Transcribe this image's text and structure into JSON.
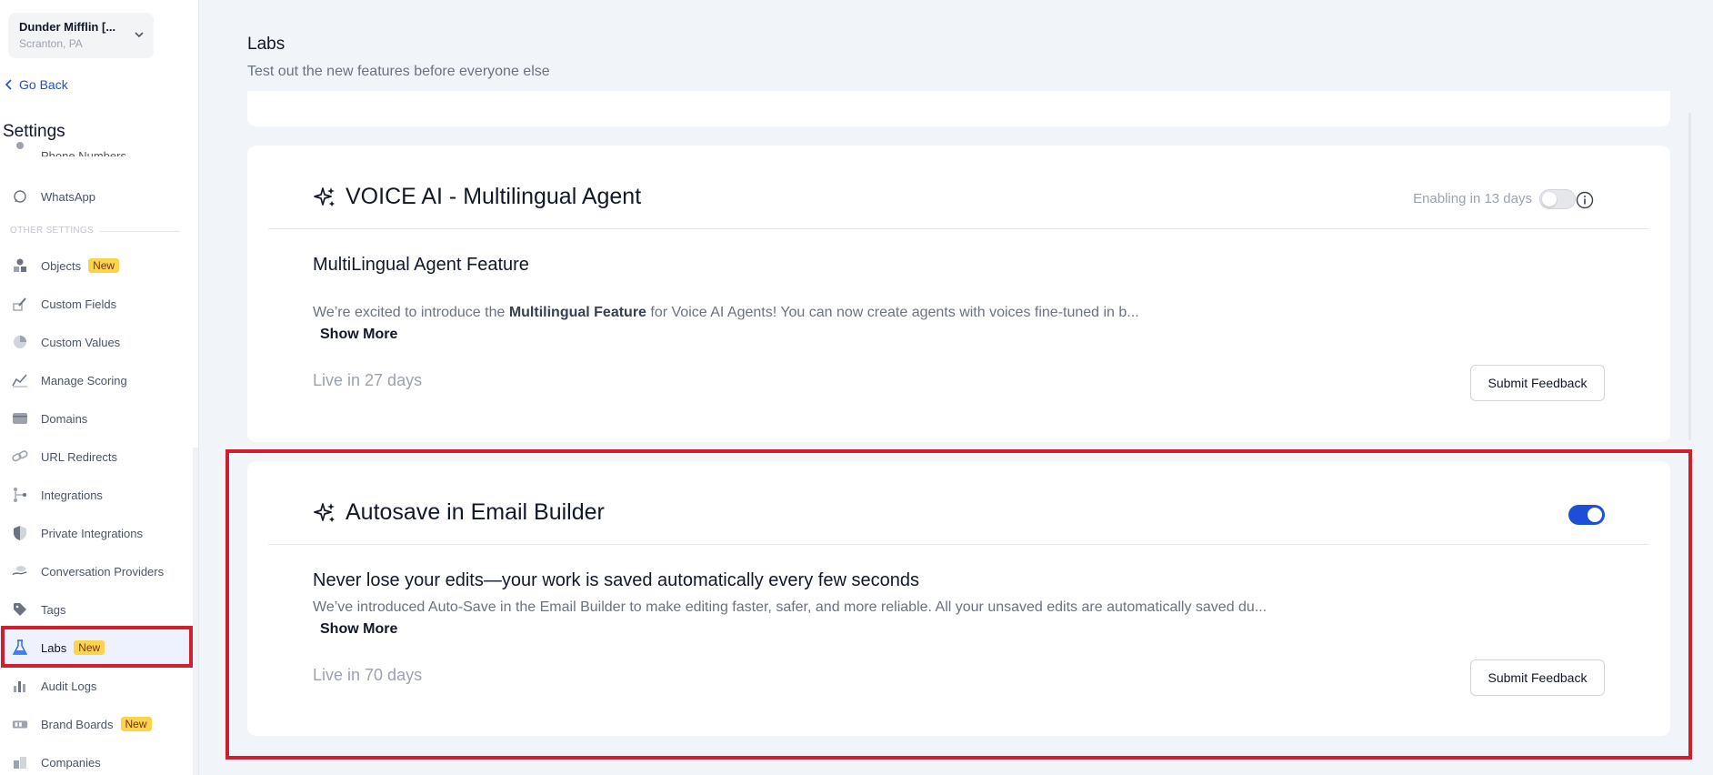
{
  "location": {
    "name": "Dunder Mifflin [...",
    "city": "Scranton, PA"
  },
  "go_back_label": "Go Back",
  "settings_title": "Settings",
  "sidebar": {
    "partial_item": "Phone Numbers",
    "whatsapp": "WhatsApp",
    "section_label": "OTHER SETTINGS",
    "items": [
      {
        "label": "Objects",
        "badge": "New"
      },
      {
        "label": "Custom Fields"
      },
      {
        "label": "Custom Values"
      },
      {
        "label": "Manage Scoring"
      },
      {
        "label": "Domains"
      },
      {
        "label": "URL Redirects"
      },
      {
        "label": "Integrations"
      },
      {
        "label": "Private Integrations"
      },
      {
        "label": "Conversation Providers"
      },
      {
        "label": "Tags"
      },
      {
        "label": "Labs",
        "badge": "New"
      },
      {
        "label": "Audit Logs"
      },
      {
        "label": "Brand Boards",
        "badge": "New"
      },
      {
        "label": "Companies"
      }
    ]
  },
  "page": {
    "title": "Labs",
    "subtitle": "Test out the new features before everyone else"
  },
  "cards": {
    "voice": {
      "title": "VOICE AI - Multilingual Agent",
      "status": "Enabling in 13 days",
      "toggle_on": false,
      "heading": "MultiLingual Agent Feature",
      "desc_pre": "We’re excited to introduce the ",
      "desc_bold": "Multilingual Feature",
      "desc_post": " for Voice AI Agents! You can now create agents with voices fine-tuned in b...",
      "show_more": "Show More",
      "live_in": "Live in 27 days",
      "feedback": "Submit Feedback"
    },
    "autosave": {
      "title": "Autosave in Email Builder",
      "toggle_on": true,
      "heading": "Never lose your edits—your work is saved automatically every few seconds",
      "desc": "We’ve introduced Auto-Save in the Email Builder to make editing faster, safer, and more reliable. All your unsaved edits are automatically saved du...",
      "show_more": "Show More",
      "live_in": "Live in 70 days",
      "feedback": "Submit Feedback"
    }
  },
  "colors": {
    "accent": "#1d4ed8",
    "highlight": "#d0202e",
    "badge": "#fcd34d"
  }
}
